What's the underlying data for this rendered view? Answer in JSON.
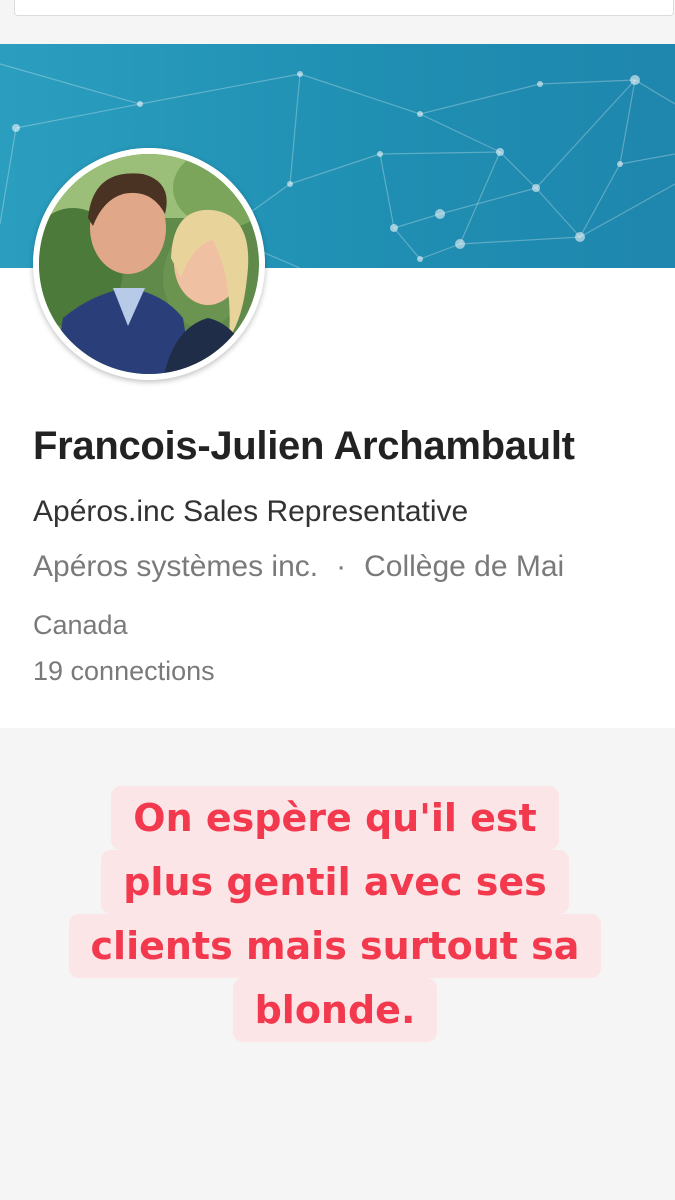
{
  "profile": {
    "name": "Francois-Julien Archambault",
    "headline": "Apéros.inc Sales Representative",
    "company": "Apéros systèmes inc.",
    "separator": "·",
    "school": "Collège de Mai",
    "location": "Canada",
    "connections": "19 connections"
  },
  "overlay": {
    "lines": [
      "On espère qu'il est",
      "plus gentil avec ses",
      "clients mais surtout sa",
      "blonde."
    ],
    "text_color": "#f2394d",
    "background_color": "#fbe5e7"
  },
  "colors": {
    "banner": "#1f8fb2",
    "name_text": "#222222",
    "secondary_text": "#7a7a7a"
  }
}
